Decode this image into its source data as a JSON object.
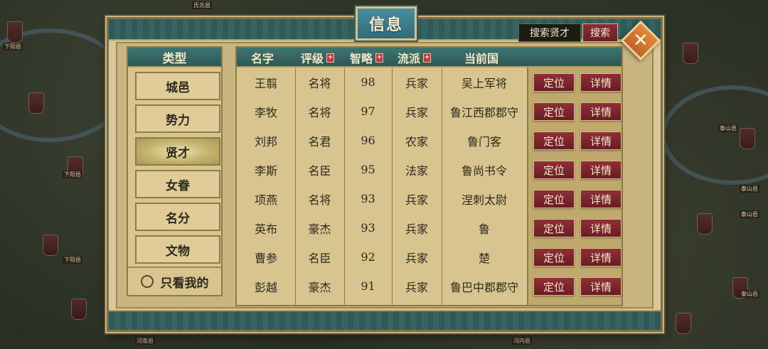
{
  "title": "信息",
  "search": {
    "value": "搜索贤才",
    "button_label": "搜索"
  },
  "close_icon": "close-icon",
  "sidebar": {
    "header": "类型",
    "items": [
      {
        "label": "城邑"
      },
      {
        "label": "势力"
      },
      {
        "label": "贤才"
      },
      {
        "label": "女眷"
      },
      {
        "label": "名分"
      },
      {
        "label": "文物"
      }
    ],
    "only_mine_label": "只看我的"
  },
  "table": {
    "headers": [
      "名字",
      "评级",
      "智略",
      "流派",
      "当前国"
    ],
    "locate_label": "定位",
    "detail_label": "详情",
    "rows": [
      {
        "name": "王翦",
        "rank": "名将",
        "intellect": "98",
        "school": "兵家",
        "nation": "吴上军将"
      },
      {
        "name": "李牧",
        "rank": "名将",
        "intellect": "97",
        "school": "兵家",
        "nation": "鲁江西郡郡守"
      },
      {
        "name": "刘邦",
        "rank": "名君",
        "intellect": "96",
        "school": "农家",
        "nation": "鲁门客"
      },
      {
        "name": "李斯",
        "rank": "名臣",
        "intellect": "95",
        "school": "法家",
        "nation": "鲁尚书令"
      },
      {
        "name": "项燕",
        "rank": "名将",
        "intellect": "93",
        "school": "兵家",
        "nation": "涅刺太尉"
      },
      {
        "name": "英布",
        "rank": "豪杰",
        "intellect": "93",
        "school": "兵家",
        "nation": "鲁"
      },
      {
        "name": "曹参",
        "rank": "名臣",
        "intellect": "92",
        "school": "兵家",
        "nation": "楚"
      },
      {
        "name": "彭越",
        "rank": "豪杰",
        "intellect": "91",
        "school": "兵家",
        "nation": "鲁巴中郡郡守"
      }
    ]
  },
  "map_labels": [
    "下阳邑",
    "下阳邑",
    "下阳邑",
    "泰山邑",
    "泰山邑",
    "泰山邑",
    "河南邑",
    "河内邑",
    "泰山邑",
    "氏北邑"
  ],
  "colors": {
    "accent_red": "#8e2f38",
    "teal": "#2d5856",
    "parchment": "#d8c48f"
  }
}
